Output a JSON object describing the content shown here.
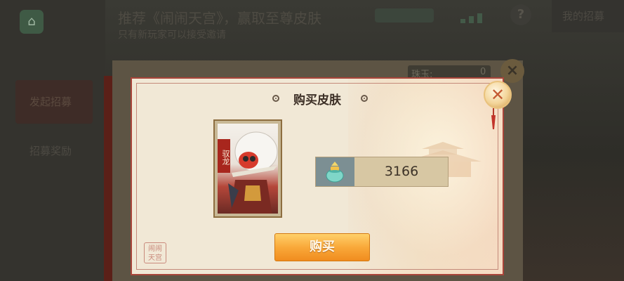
{
  "background": {
    "title": "推荐《闹闹天宫》，赢取至尊皮肤",
    "subtitle": "只有新玩家可以接受邀请",
    "right_label": "我的招募",
    "nav_items": [
      "发起招募",
      "招募奖励"
    ],
    "currency_label": "珠玉:",
    "currency_value": "0"
  },
  "dialog": {
    "title": "购买皮肤",
    "card_banner": "驭龙",
    "price": "3166",
    "buy_label": "购买",
    "seal_text": "闹闹天宫"
  },
  "icons": {
    "close": "close-icon",
    "currency": "jade-pot-icon"
  },
  "colors": {
    "accent_border": "#a9453a",
    "button": "#f9a93a"
  }
}
